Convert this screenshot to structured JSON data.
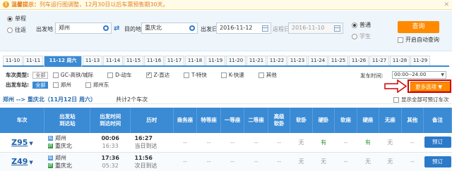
{
  "notice": {
    "label": "温馨提示：",
    "text": "列车运行图调整，12月30日以后车票预售期30天。"
  },
  "search": {
    "trip_types": [
      {
        "label": "单程",
        "selected": true
      },
      {
        "label": "往返",
        "selected": false
      }
    ],
    "from_label": "出发地",
    "from_value": "郑州",
    "to_label": "目的地",
    "to_value": "重庆北",
    "depart_label": "出发日",
    "depart_value": "2016-11-12",
    "return_label": "返程日",
    "return_value": "2016-11-10",
    "passenger_types": [
      {
        "label": "普通",
        "selected": true
      },
      {
        "label": "学生",
        "selected": false
      }
    ],
    "query_label": "查询",
    "auto_query_label": "开启自动查询"
  },
  "date_tabs": [
    {
      "label": "11-10",
      "active": false
    },
    {
      "label": "11-11",
      "active": false
    },
    {
      "label": "11-12 周六",
      "active": true
    },
    {
      "label": "11-13",
      "active": false
    },
    {
      "label": "11-14",
      "active": false
    },
    {
      "label": "11-15",
      "active": false
    },
    {
      "label": "11-16",
      "active": false
    },
    {
      "label": "11-17",
      "active": false
    },
    {
      "label": "11-18",
      "active": false
    },
    {
      "label": "11-19",
      "active": false
    },
    {
      "label": "11-20",
      "active": false
    },
    {
      "label": "11-21",
      "active": false
    },
    {
      "label": "11-22",
      "active": false
    },
    {
      "label": "11-23",
      "active": false
    },
    {
      "label": "11-24",
      "active": false
    },
    {
      "label": "11-25",
      "active": false
    },
    {
      "label": "11-26",
      "active": false
    },
    {
      "label": "11-27",
      "active": false
    },
    {
      "label": "11-28",
      "active": false
    },
    {
      "label": "11-29",
      "active": false
    }
  ],
  "filters": {
    "type_label": "车次类型:",
    "all_label": "全部",
    "types": [
      {
        "label": "GC-高铁/城际",
        "checked": false
      },
      {
        "label": "D-动车",
        "checked": false
      },
      {
        "label": "Z-直达",
        "checked": true
      },
      {
        "label": "T-特快",
        "checked": false
      },
      {
        "label": "K-快速",
        "checked": false
      },
      {
        "label": "其他",
        "checked": false
      }
    ],
    "station_label": "出发车站:",
    "stations": [
      {
        "label": "郑州",
        "checked": false
      },
      {
        "label": "郑州东",
        "checked": false
      }
    ],
    "time_label": "发车时间:",
    "time_value": "00:00--24:00",
    "more_label": "更多选项"
  },
  "result": {
    "route": "郑州 --> 重庆北（11月12日 周六）",
    "count": "共计2个车次",
    "show_all_label": "显示全部可预订车次"
  },
  "table": {
    "headers": [
      "车次",
      "出发站\n到达站",
      "出发时间\n到达时间",
      "历时",
      "商务座",
      "特等座",
      "一等座",
      "二等座",
      "高级\n软卧",
      "软卧",
      "硬卧",
      "软座",
      "硬座",
      "无座",
      "其他",
      "备注"
    ],
    "rows": [
      {
        "train": "Z95",
        "from_badge": "始",
        "from": "郑州",
        "to_badge": "终",
        "to": "重庆北",
        "depart": "00:06",
        "arrive": "16:33",
        "duration": "16:27",
        "day_note": "当日到达",
        "seats": [
          "--",
          "--",
          "--",
          "--",
          "--",
          "无",
          "有",
          "--",
          "有",
          "无",
          "--"
        ],
        "action": "预订"
      },
      {
        "train": "Z49",
        "from_badge": "始",
        "from": "郑州",
        "to_badge": "终",
        "to": "重庆北",
        "depart": "17:36",
        "arrive": "05:32",
        "duration": "11:56",
        "day_note": "次日到达",
        "seats": [
          "--",
          "--",
          "--",
          "--",
          "--",
          "无",
          "无",
          "--",
          "无",
          "无",
          "--"
        ],
        "action": "预订"
      }
    ]
  }
}
